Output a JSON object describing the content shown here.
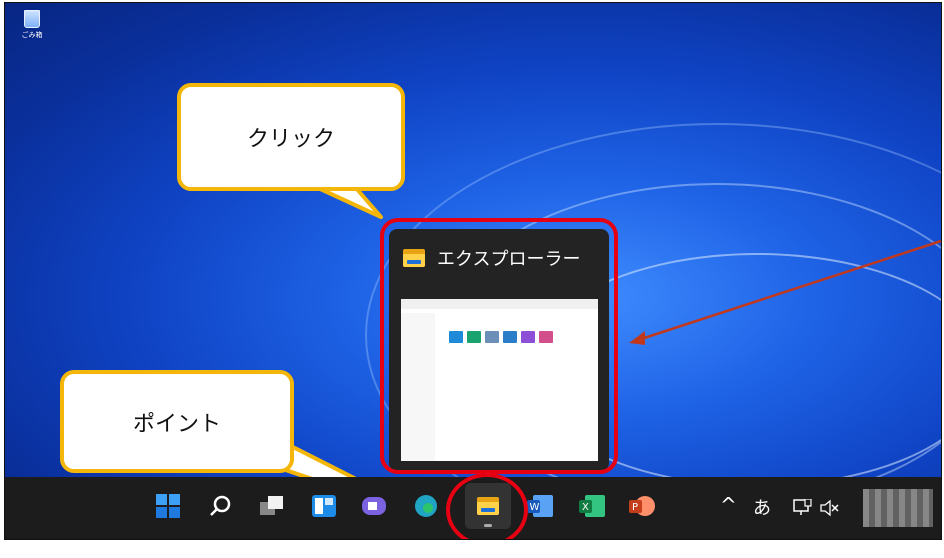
{
  "desktop": {
    "recycle_bin_label": "ごみ箱"
  },
  "callouts": {
    "click_label": "クリック",
    "point_label": "ポイント"
  },
  "preview": {
    "title": "エクスプローラー"
  },
  "taskbar": {
    "items": [
      "start",
      "search",
      "task-view",
      "widgets",
      "chat",
      "edge",
      "file-explorer",
      "word",
      "excel",
      "powerpoint"
    ],
    "tray": {
      "chevron": "^",
      "ime": "あ"
    }
  },
  "colors": {
    "callout_border": "#f5b60a",
    "annotation_red": "#e60012",
    "arrow_red": "#c0381e",
    "taskbar_bg": "#1c1c1c"
  }
}
